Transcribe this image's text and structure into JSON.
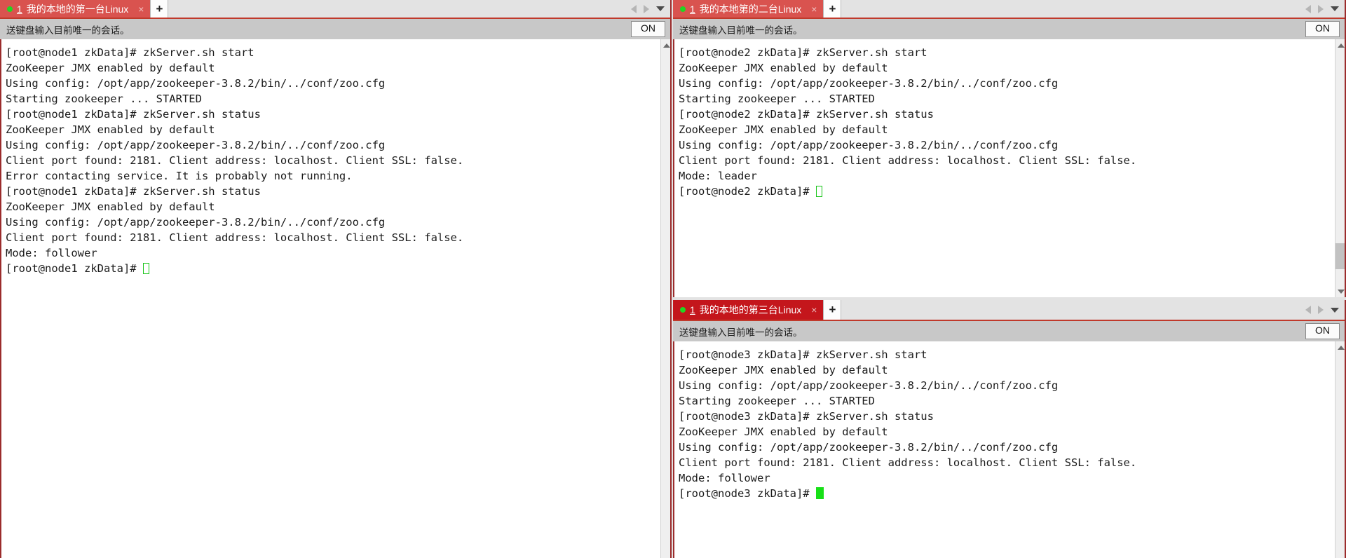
{
  "app": {
    "bg_color": "#e3e3e3",
    "tab_red": "#d9534f",
    "tab_red_active": "#c4161c",
    "accent_red": "#9b2c2c",
    "toolbar_bg": "#c8c8c8",
    "cursor_green": "#17e017"
  },
  "panes": [
    {
      "id": "pane-1",
      "tab": {
        "status_dot": "session-active-dot",
        "number": "1",
        "label": "我的本地的第一台Linux",
        "close_label": "×",
        "new_tab_label": "+",
        "active_style": "normal"
      },
      "nav": {
        "prev_label": "prev-tab",
        "next_label": "next-tab",
        "menu_label": "tab-list-menu"
      },
      "toolbar": {
        "text": "送键盘输入目前唯一的会话。",
        "toggle_label": "ON"
      },
      "terminal": {
        "lines": [
          "[root@node1 zkData]# zkServer.sh start",
          "ZooKeeper JMX enabled by default",
          "Using config: /opt/app/zookeeper-3.8.2/bin/../conf/zoo.cfg",
          "Starting zookeeper ... STARTED",
          "[root@node1 zkData]# zkServer.sh status",
          "ZooKeeper JMX enabled by default",
          "Using config: /opt/app/zookeeper-3.8.2/bin/../conf/zoo.cfg",
          "Client port found: 2181. Client address: localhost. Client SSL: false.",
          "Error contacting service. It is probably not running.",
          "[root@node1 zkData]# zkServer.sh status",
          "ZooKeeper JMX enabled by default",
          "Using config: /opt/app/zookeeper-3.8.2/bin/../conf/zoo.cfg",
          "Client port found: 2181. Client address: localhost. Client SSL: false.",
          "Mode: follower"
        ],
        "prompt": "[root@node1 zkData]# ",
        "cursor_style": "hollow"
      },
      "scrollbar": {
        "up_label": "scroll-up",
        "down_label": "scroll-down",
        "has_down_button": false,
        "thumb_top_pct": 0,
        "thumb_height_pct": 0
      }
    },
    {
      "id": "pane-2",
      "tab": {
        "status_dot": "session-active-dot",
        "number": "1",
        "label": "我的本地第的二台Linux",
        "close_label": "×",
        "new_tab_label": "+",
        "active_style": "normal"
      },
      "nav": {
        "prev_label": "prev-tab",
        "next_label": "next-tab",
        "menu_label": "tab-list-menu"
      },
      "toolbar": {
        "text": "送键盘输入目前唯一的会话。",
        "toggle_label": "ON"
      },
      "terminal": {
        "lines": [
          "[root@node2 zkData]# zkServer.sh start",
          "ZooKeeper JMX enabled by default",
          "Using config: /opt/app/zookeeper-3.8.2/bin/../conf/zoo.cfg",
          "Starting zookeeper ... STARTED",
          "[root@node2 zkData]# zkServer.sh status",
          "ZooKeeper JMX enabled by default",
          "Using config: /opt/app/zookeeper-3.8.2/bin/../conf/zoo.cfg",
          "Client port found: 2181. Client address: localhost. Client SSL: false.",
          "Mode: leader"
        ],
        "prompt": "[root@node2 zkData]# ",
        "cursor_style": "hollow"
      },
      "scrollbar": {
        "up_label": "scroll-up",
        "down_label": "scroll-down",
        "has_down_button": true,
        "thumb_top_pct": 82,
        "thumb_height_pct": 11
      }
    },
    {
      "id": "pane-3",
      "tab": {
        "status_dot": "session-active-dot",
        "number": "1",
        "label": "我的本地的第三台Linux",
        "close_label": "×",
        "new_tab_label": "+",
        "active_style": "strong"
      },
      "nav": {
        "prev_label": "prev-tab",
        "next_label": "next-tab",
        "menu_label": "tab-list-menu"
      },
      "toolbar": {
        "text": "送键盘输入目前唯一的会话。",
        "toggle_label": "ON"
      },
      "terminal": {
        "lines": [
          "[root@node3 zkData]# zkServer.sh start",
          "ZooKeeper JMX enabled by default",
          "Using config: /opt/app/zookeeper-3.8.2/bin/../conf/zoo.cfg",
          "Starting zookeeper ... STARTED",
          "[root@node3 zkData]# zkServer.sh status",
          "ZooKeeper JMX enabled by default",
          "Using config: /opt/app/zookeeper-3.8.2/bin/../conf/zoo.cfg",
          "Client port found: 2181. Client address: localhost. Client SSL: false.",
          "Mode: follower"
        ],
        "prompt": "[root@node3 zkData]# ",
        "cursor_style": "solid"
      },
      "scrollbar": {
        "up_label": "scroll-up",
        "down_label": "scroll-down",
        "has_down_button": false,
        "thumb_top_pct": 0,
        "thumb_height_pct": 0
      }
    }
  ]
}
